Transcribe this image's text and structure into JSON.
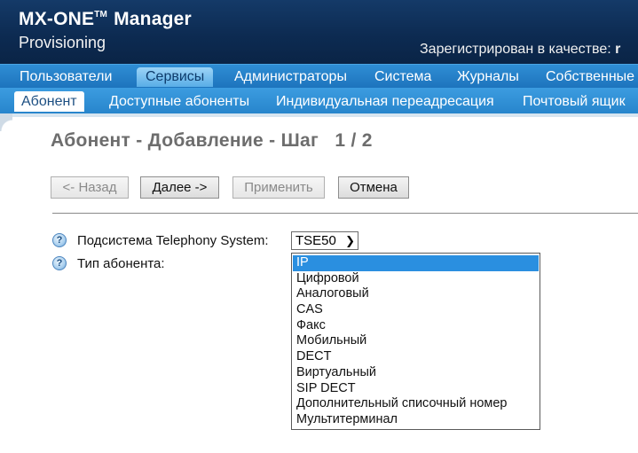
{
  "header": {
    "brand": "MX-ONE",
    "brand_tm": "TM",
    "brand_rest": "Manager",
    "subtitle": "Provisioning",
    "user_label": "Зарегистрирован в качестве:",
    "user_name": "r"
  },
  "mainnav": {
    "items": [
      {
        "label": "Пользователи"
      },
      {
        "label": "Сервисы",
        "active": true
      },
      {
        "label": "Администраторы"
      },
      {
        "label": "Система"
      },
      {
        "label": "Журналы"
      },
      {
        "label": "Собственные"
      }
    ]
  },
  "subnav": {
    "items": [
      {
        "label": "Абонент",
        "active": true
      },
      {
        "label": "Доступные абоненты"
      },
      {
        "label": "Индивидуальная переадресация"
      },
      {
        "label": "Почтовый ящик"
      }
    ]
  },
  "page": {
    "title": "Абонент - Добавление - Шаг   1 / 2"
  },
  "buttons": {
    "back": "<- Назад",
    "next": "Далее ->",
    "apply": "Применить",
    "cancel": "Отмена"
  },
  "form": {
    "subsystem_label": "Подсистема Telephony System:",
    "subsystem_value": "TSE50",
    "subscriber_type_label": "Тип абонента:",
    "help_icon": "?",
    "subscriber_type_options": [
      "IP",
      "Цифровой",
      "Аналоговый",
      "CAS",
      "Факс",
      "Мобильный",
      "DECT",
      "Виртуальный",
      "SIP DECT",
      "Дополнительный списочный номер",
      "Мультитерминал"
    ],
    "subscriber_type_selected": "IP"
  },
  "colors": {
    "header_bg": "#0d2b52",
    "nav_bg": "#1d74bd",
    "nav_active": "#58ade7",
    "selected_option": "#2a8fe0"
  }
}
